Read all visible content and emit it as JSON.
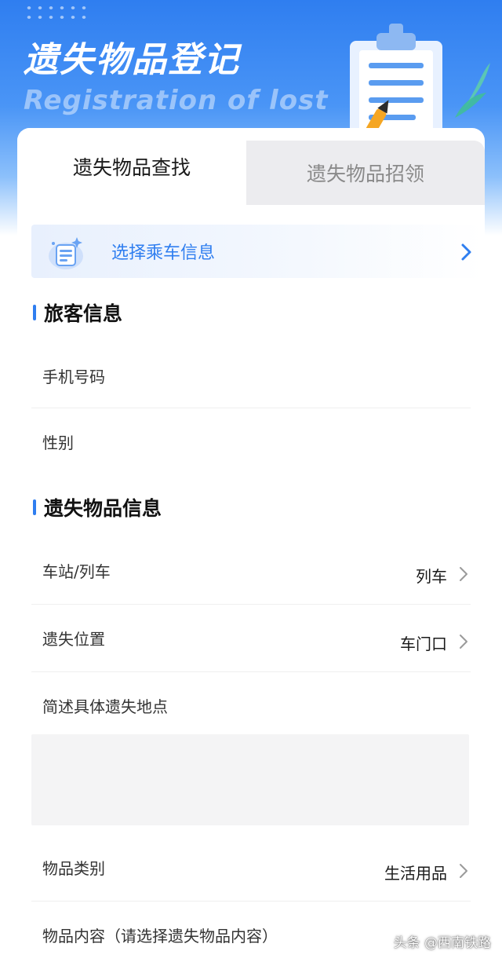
{
  "header": {
    "title_cn": "遗失物品登记",
    "title_en": "Registration of lost"
  },
  "tabs": [
    {
      "label": "遗失物品查找",
      "active": true
    },
    {
      "label": "遗失物品招领",
      "active": false
    }
  ],
  "trip_banner": {
    "label": "选择乘车信息",
    "icon": "ticket-icon"
  },
  "passenger_section": {
    "title": "旅客信息",
    "fields": [
      {
        "label": "手机号码",
        "value": ""
      },
      {
        "label": "性别",
        "value": ""
      }
    ]
  },
  "item_section": {
    "title": "遗失物品信息",
    "fields": [
      {
        "label": "车站/列车",
        "value": "列车"
      },
      {
        "label": "遗失位置",
        "value": "车门口"
      },
      {
        "label": "简述具体遗失地点",
        "value": ""
      },
      {
        "label": "物品类别",
        "value": "生活用品"
      },
      {
        "label": "物品内容（请选择遗失物品内容）",
        "value": ""
      }
    ]
  },
  "watermark": "头条 @西南铁路",
  "colors": {
    "accent": "#2f7ef0",
    "header_top": "#2f7ef0",
    "tab_inactive_bg": "#ececef",
    "textarea_bg": "#f4f4f5"
  }
}
